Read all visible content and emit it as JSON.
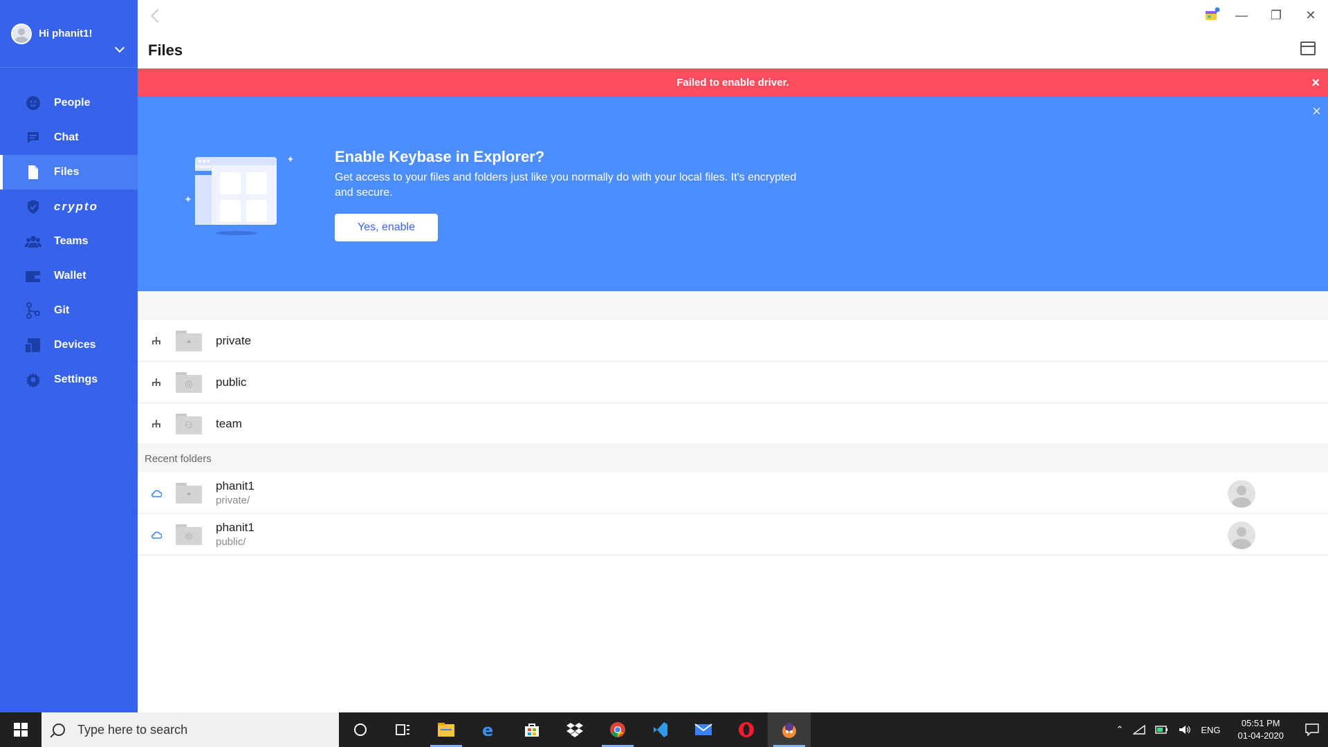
{
  "sidebar": {
    "user_greeting": "Hi phanit1!",
    "items": [
      {
        "label": "People",
        "icon": "people-icon"
      },
      {
        "label": "Chat",
        "icon": "chat-icon"
      },
      {
        "label": "Files",
        "icon": "files-icon",
        "active": true
      },
      {
        "label": "crypto",
        "icon": "crypto-shield-icon"
      },
      {
        "label": "Teams",
        "icon": "teams-icon"
      },
      {
        "label": "Wallet",
        "icon": "wallet-icon"
      },
      {
        "label": "Git",
        "icon": "git-icon"
      },
      {
        "label": "Devices",
        "icon": "devices-icon"
      },
      {
        "label": "Settings",
        "icon": "settings-icon"
      }
    ]
  },
  "header": {
    "title": "Files"
  },
  "error_banner": {
    "message": "Failed to enable driver.",
    "close": "×"
  },
  "enable_banner": {
    "title": "Enable Keybase in Explorer?",
    "description": "Get access to your files and folders just like you normally do with your local files. It's encrypted and secure.",
    "button_label": "Yes, enable",
    "close": "×"
  },
  "folders": [
    {
      "name": "private",
      "icon": "private-folder-icon"
    },
    {
      "name": "public",
      "icon": "public-folder-icon"
    },
    {
      "name": "team",
      "icon": "team-folder-icon"
    }
  ],
  "recent": {
    "header": "Recent folders",
    "items": [
      {
        "name": "phanit1",
        "path": "private/"
      },
      {
        "name": "phanit1",
        "path": "public/"
      }
    ]
  },
  "taskbar": {
    "search_placeholder": "Type here to search",
    "language": "ENG",
    "time": "05:51 PM",
    "date": "01-04-2020"
  },
  "colors": {
    "sidebar": "#3663ea",
    "error": "#ff4c5e",
    "banner": "#4c8eff"
  }
}
